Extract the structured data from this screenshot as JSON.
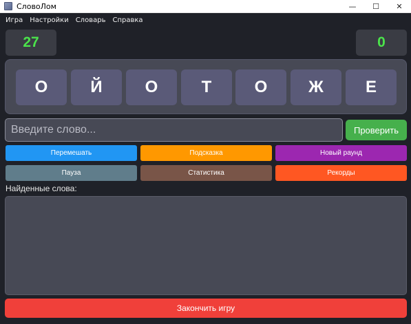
{
  "window": {
    "title": "СловоЛом",
    "minimize_glyph": "—",
    "maximize_glyph": "☐",
    "close_glyph": "✕"
  },
  "menu": {
    "items": [
      "Игра",
      "Настройки",
      "Словарь",
      "Справка"
    ]
  },
  "scores": {
    "left": "27",
    "right": "0",
    "value_color": "#4be34b"
  },
  "letters": [
    "О",
    "Й",
    "О",
    "Т",
    "О",
    "Ж",
    "Е"
  ],
  "input": {
    "placeholder": "Введите слово...",
    "value": ""
  },
  "check_button": {
    "label": "Проверить",
    "color": "#46b04c"
  },
  "actions": [
    {
      "label": "Перемешать",
      "color": "#2196f3"
    },
    {
      "label": "Подсказка",
      "color": "#ff9800"
    },
    {
      "label": "Новый раунд",
      "color": "#9c27b0"
    },
    {
      "label": "Пауза",
      "color": "#607d8b"
    },
    {
      "label": "Статистика",
      "color": "#795548"
    },
    {
      "label": "Рекорды",
      "color": "#ff5722"
    }
  ],
  "found": {
    "label": "Найденные слова:",
    "words": []
  },
  "end_button": {
    "label": "Закончить игру",
    "color": "#f0403a"
  }
}
